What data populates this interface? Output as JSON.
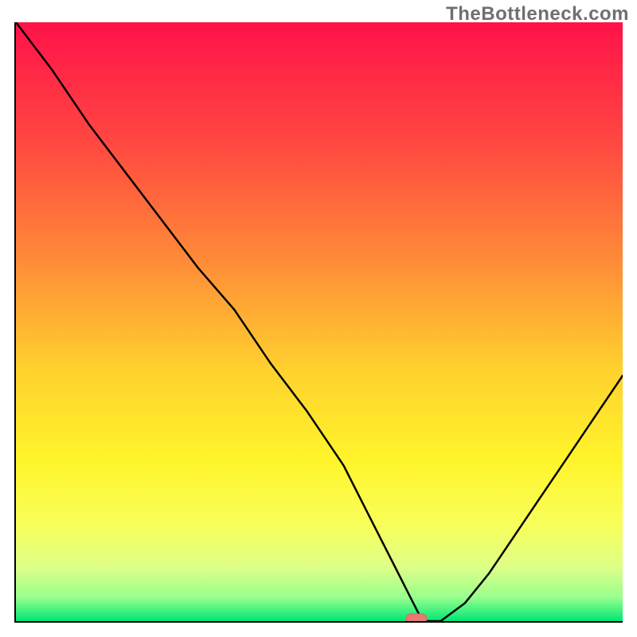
{
  "watermark": "TheBottleneck.com",
  "colors": {
    "gradient_stops": [
      {
        "offset": 0.0,
        "color": "#ff1249"
      },
      {
        "offset": 0.2,
        "color": "#ff4741"
      },
      {
        "offset": 0.4,
        "color": "#ff8c38"
      },
      {
        "offset": 0.58,
        "color": "#ffd12e"
      },
      {
        "offset": 0.73,
        "color": "#fff42b"
      },
      {
        "offset": 0.84,
        "color": "#f8ff5a"
      },
      {
        "offset": 0.91,
        "color": "#ddff88"
      },
      {
        "offset": 0.96,
        "color": "#99ff8d"
      },
      {
        "offset": 1.0,
        "color": "#00e775"
      }
    ],
    "curve": "#000000",
    "marker_fill": "#e77a74",
    "marker_stroke": "#d86a64"
  },
  "chart_data": {
    "type": "line",
    "x": [
      0.0,
      0.06,
      0.12,
      0.18,
      0.24,
      0.3,
      0.36,
      0.42,
      0.48,
      0.54,
      0.58,
      0.62,
      0.65,
      0.67,
      0.7,
      0.74,
      0.78,
      0.82,
      0.86,
      0.9,
      0.94,
      0.98,
      1.0
    ],
    "values": [
      1.0,
      0.92,
      0.83,
      0.75,
      0.67,
      0.59,
      0.52,
      0.43,
      0.35,
      0.26,
      0.18,
      0.1,
      0.04,
      0.0,
      0.0,
      0.03,
      0.08,
      0.14,
      0.2,
      0.26,
      0.32,
      0.38,
      0.41
    ],
    "title": "",
    "xlabel": "",
    "ylabel": "",
    "xlim": [
      0,
      1
    ],
    "ylim": [
      0,
      1
    ],
    "marker": {
      "x": 0.66,
      "y": 0.0
    },
    "series": [
      {
        "name": "bottleneck-curve",
        "x_key": "x",
        "y_key": "values"
      }
    ]
  }
}
